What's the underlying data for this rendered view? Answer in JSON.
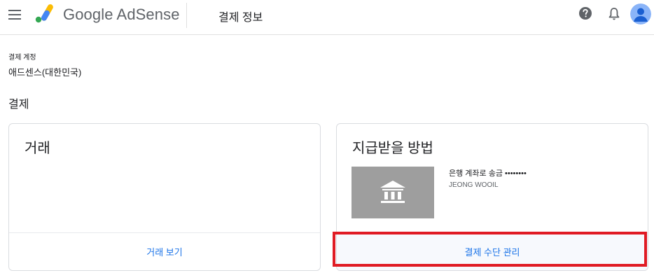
{
  "app": {
    "brand": "Google AdSense",
    "page_title": "결제 정보"
  },
  "account": {
    "label": "결제 계정",
    "value": "애드센스(대한민국)"
  },
  "section": {
    "title": "결제"
  },
  "transactions_card": {
    "heading": "거래",
    "footer_link": "거래 보기"
  },
  "payment_card": {
    "heading": "지급받을 방법",
    "method": "은행 계좌로 송금 ••••••••",
    "holder": "JEONG WOOIL",
    "footer_link": "결제 수단 관리",
    "thumb_icon": "bank-icon"
  },
  "icons": [
    "menu-icon",
    "adsense-logo-icon",
    "help-icon",
    "bell-icon",
    "avatar-icon"
  ],
  "colors": {
    "link": "#1a73e8",
    "highlight": "#e01b24",
    "avatar": "#8ab4f8",
    "thumb": "#9e9e9e"
  }
}
